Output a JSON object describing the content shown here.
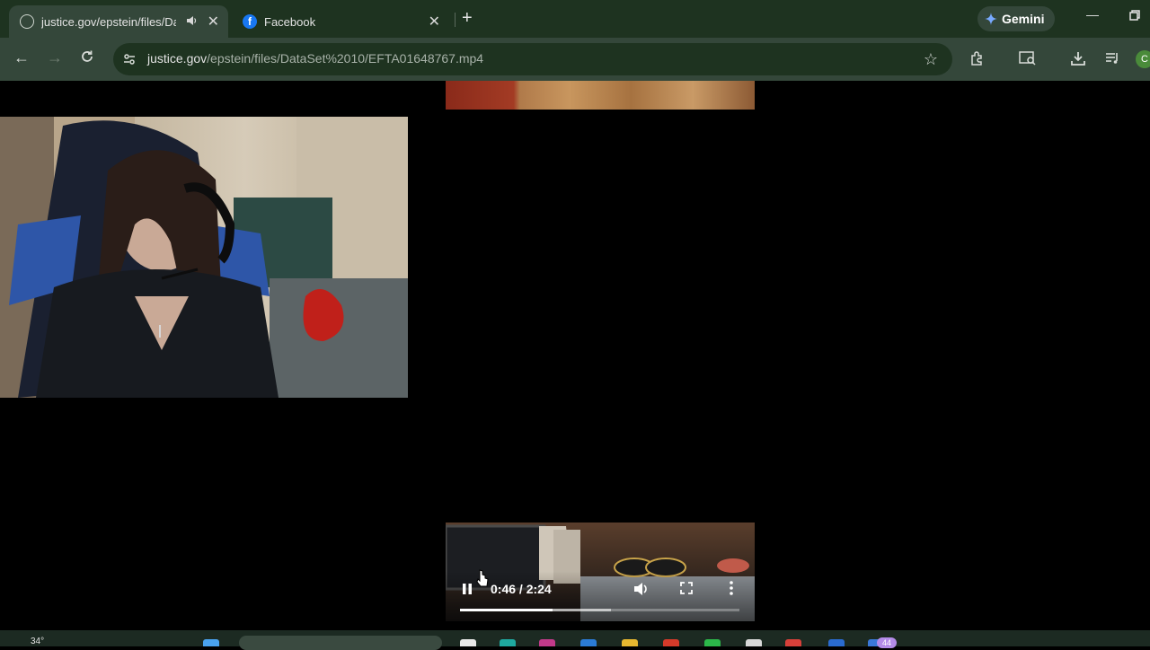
{
  "browser": {
    "tabs": [
      {
        "title": "justice.gov/epstein/files/Da",
        "active": true,
        "audio": true
      },
      {
        "title": "Facebook",
        "active": false
      }
    ],
    "new_tab_label": "+",
    "gemini_label": "Gemini",
    "url_host": "justice.gov",
    "url_path": "/epstein/files/DataSet%2010/EFTA01648767.mp4",
    "profile_initial": "C"
  },
  "video_player": {
    "current_time": "0:46",
    "duration": "2:24",
    "time_display": "0:46 / 2:24",
    "progress_played": 0.33,
    "progress_buffered": 0.54,
    "state": "playing"
  },
  "taskbar": {
    "temperature": "34°",
    "notification_badge": "44"
  },
  "colors": {
    "tabbar_bg": "#1e3320",
    "toolbar_bg": "#34473a",
    "page_bg": "#000000",
    "accent": "#1877f2"
  }
}
